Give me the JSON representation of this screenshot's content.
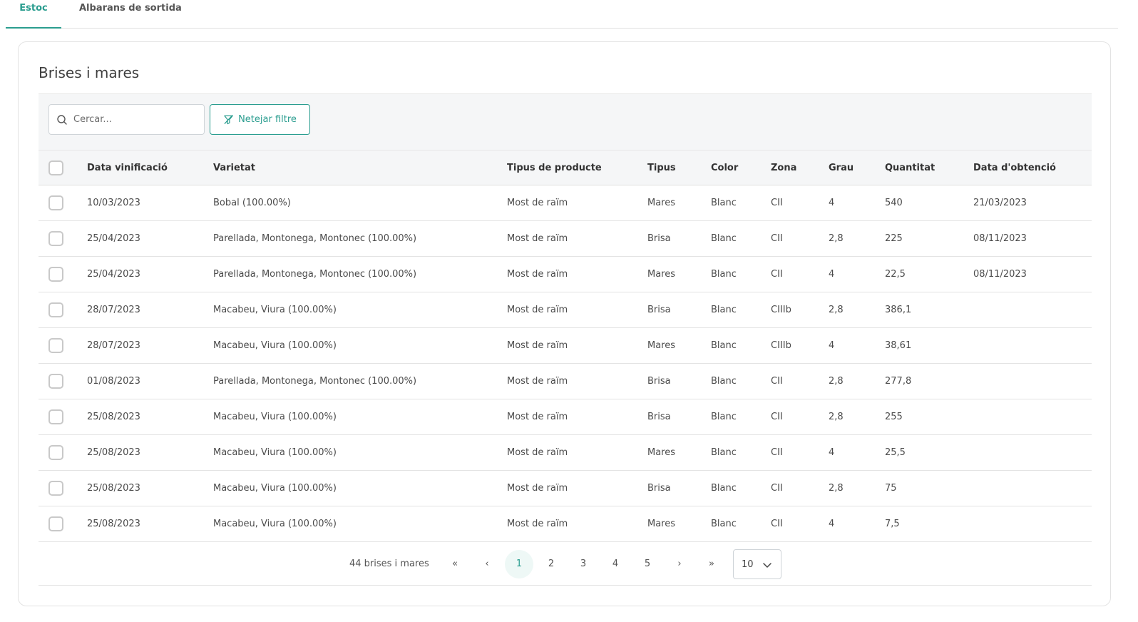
{
  "tabs": [
    {
      "label": "Estoc"
    },
    {
      "label": "Albarans de sortida"
    }
  ],
  "card": {
    "title": "Brises i mares"
  },
  "toolbar": {
    "search_placeholder": "Cercar...",
    "clear_label": "Netejar filtre"
  },
  "table": {
    "headers": {
      "date": "Data vinificació",
      "variety": "Varietat",
      "product": "Tipus de producte",
      "type": "Tipus",
      "color": "Color",
      "zone": "Zona",
      "grade": "Grau",
      "quantity": "Quantitat",
      "obtained": "Data d'obtenció"
    },
    "rows": [
      {
        "date": "10/03/2023",
        "variety": "Bobal (100.00%)",
        "product": "Most de raïm",
        "type": "Mares",
        "color": "Blanc",
        "zone": "CII",
        "grade": "4",
        "quantity": "540",
        "obtained": "21/03/2023"
      },
      {
        "date": "25/04/2023",
        "variety": "Parellada, Montonega, Montonec (100.00%)",
        "product": "Most de raïm",
        "type": "Brisa",
        "color": "Blanc",
        "zone": "CII",
        "grade": "2,8",
        "quantity": "225",
        "obtained": "08/11/2023"
      },
      {
        "date": "25/04/2023",
        "variety": "Parellada, Montonega, Montonec (100.00%)",
        "product": "Most de raïm",
        "type": "Mares",
        "color": "Blanc",
        "zone": "CII",
        "grade": "4",
        "quantity": "22,5",
        "obtained": "08/11/2023"
      },
      {
        "date": "28/07/2023",
        "variety": "Macabeu, Viura (100.00%)",
        "product": "Most de raïm",
        "type": "Brisa",
        "color": "Blanc",
        "zone": "CIIIb",
        "grade": "2,8",
        "quantity": "386,1",
        "obtained": ""
      },
      {
        "date": "28/07/2023",
        "variety": "Macabeu, Viura (100.00%)",
        "product": "Most de raïm",
        "type": "Mares",
        "color": "Blanc",
        "zone": "CIIIb",
        "grade": "4",
        "quantity": "38,61",
        "obtained": ""
      },
      {
        "date": "01/08/2023",
        "variety": "Parellada, Montonega, Montonec (100.00%)",
        "product": "Most de raïm",
        "type": "Brisa",
        "color": "Blanc",
        "zone": "CII",
        "grade": "2,8",
        "quantity": "277,8",
        "obtained": ""
      },
      {
        "date": "25/08/2023",
        "variety": "Macabeu, Viura (100.00%)",
        "product": "Most de raïm",
        "type": "Brisa",
        "color": "Blanc",
        "zone": "CII",
        "grade": "2,8",
        "quantity": "255",
        "obtained": ""
      },
      {
        "date": "25/08/2023",
        "variety": "Macabeu, Viura (100.00%)",
        "product": "Most de raïm",
        "type": "Mares",
        "color": "Blanc",
        "zone": "CII",
        "grade": "4",
        "quantity": "25,5",
        "obtained": ""
      },
      {
        "date": "25/08/2023",
        "variety": "Macabeu, Viura (100.00%)",
        "product": "Most de raïm",
        "type": "Brisa",
        "color": "Blanc",
        "zone": "CII",
        "grade": "2,8",
        "quantity": "75",
        "obtained": ""
      },
      {
        "date": "25/08/2023",
        "variety": "Macabeu, Viura (100.00%)",
        "product": "Most de raïm",
        "type": "Mares",
        "color": "Blanc",
        "zone": "CII",
        "grade": "4",
        "quantity": "7,5",
        "obtained": ""
      }
    ]
  },
  "pagination": {
    "total_label": "44 brises i mares",
    "first": "«",
    "prev": "‹",
    "pages": [
      "1",
      "2",
      "3",
      "4",
      "5"
    ],
    "current_page": "1",
    "next": "›",
    "last": "»",
    "page_size": "10"
  },
  "colors": {
    "accent": "#2a9d8f"
  }
}
